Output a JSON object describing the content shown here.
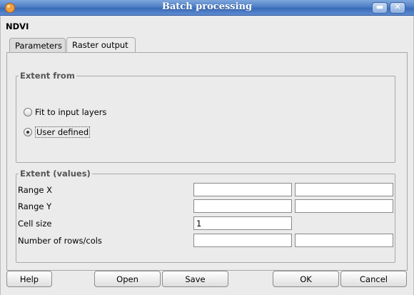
{
  "window": {
    "title": "Batch processing"
  },
  "algorithm": {
    "name": "NDVI"
  },
  "tabs": [
    {
      "label": "Parameters"
    },
    {
      "label": "Raster output"
    }
  ],
  "extent_from": {
    "title": "Extent from",
    "options": [
      {
        "label": "Fit to input layers",
        "checked": false
      },
      {
        "label": "User defined",
        "checked": true
      }
    ]
  },
  "extent_values": {
    "title": "Extent (values)",
    "rows": [
      {
        "label": "Range X",
        "value_a": "",
        "value_b": ""
      },
      {
        "label": "Range Y",
        "value_a": "",
        "value_b": ""
      },
      {
        "label": "Cell size",
        "value_a": "1"
      },
      {
        "label": "Number of rows/cols",
        "value_a": "",
        "value_b": ""
      }
    ]
  },
  "buttons": {
    "help": "Help",
    "open": "Open",
    "save": "Save",
    "ok": "OK",
    "cancel": "Cancel"
  }
}
